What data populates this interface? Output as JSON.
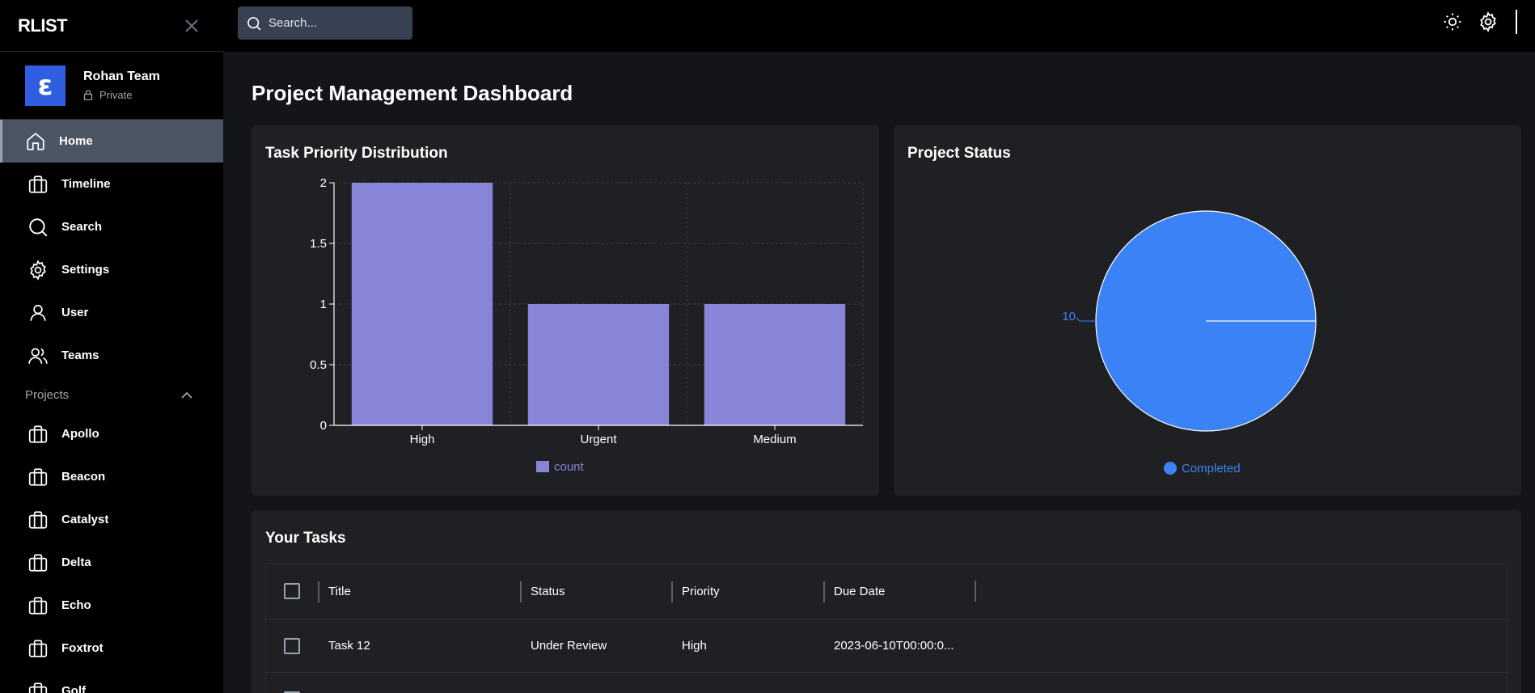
{
  "app": {
    "brand": "RLIST"
  },
  "team": {
    "name": "Rohan Team",
    "privacy": "Private",
    "logo_letter": "ε"
  },
  "nav": [
    {
      "label": "Home",
      "icon": "home-icon",
      "active": true
    },
    {
      "label": "Timeline",
      "icon": "briefcase-icon"
    },
    {
      "label": "Search",
      "icon": "search-icon"
    },
    {
      "label": "Settings",
      "icon": "gear-icon"
    },
    {
      "label": "User",
      "icon": "user-icon"
    },
    {
      "label": "Teams",
      "icon": "users-icon"
    }
  ],
  "projects": {
    "heading": "Projects",
    "items": [
      {
        "label": "Apollo",
        "icon": "briefcase-icon"
      },
      {
        "label": "Beacon",
        "icon": "briefcase-icon"
      },
      {
        "label": "Catalyst",
        "icon": "briefcase-icon"
      },
      {
        "label": "Delta",
        "icon": "briefcase-icon"
      },
      {
        "label": "Echo",
        "icon": "briefcase-icon"
      },
      {
        "label": "Foxtrot",
        "icon": "briefcase-icon"
      },
      {
        "label": "Golf",
        "icon": "briefcase-icon"
      }
    ]
  },
  "search": {
    "placeholder": "Search..."
  },
  "page": {
    "title": "Project Management Dashboard"
  },
  "colors": {
    "bar": "#8884d8",
    "pie": "#3b82f6",
    "active_nav": "#4b5563",
    "team_logo": "#2f5fe0"
  },
  "chart_data": [
    {
      "type": "bar",
      "title": "Task Priority Distribution",
      "categories": [
        "High",
        "Urgent",
        "Medium"
      ],
      "series": [
        {
          "name": "count",
          "values": [
            2,
            1,
            1
          ]
        }
      ],
      "ylim": [
        0,
        2
      ],
      "yticks": [
        "0",
        "0.5",
        "1",
        "1.5",
        "2"
      ],
      "grid": true,
      "legend": "bottom-center"
    },
    {
      "type": "pie",
      "title": "Project Status",
      "slices": [
        {
          "label": "Completed",
          "value": 10
        }
      ],
      "data_label": "10",
      "legend": "bottom-center"
    }
  ],
  "tasks": {
    "title": "Your Tasks",
    "columns": [
      "Title",
      "Status",
      "Priority",
      "Due Date"
    ],
    "rows": [
      {
        "title": "Task 12",
        "status": "Under Review",
        "priority": "High",
        "due": "2023-06-10T00:00:0..."
      }
    ]
  }
}
